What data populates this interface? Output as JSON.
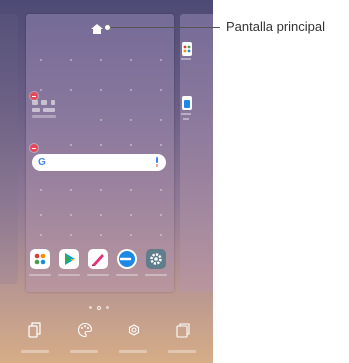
{
  "callout": {
    "label": "Pantalla principal"
  },
  "search": {
    "logo": "G"
  },
  "colors": {
    "wallpaper_top": "#4d4a75",
    "wallpaper_bottom": "#d6ad87",
    "remove_badge": "#e64a5a",
    "search_bar": "#ffffff"
  },
  "home_card": {
    "icon": "home-icon"
  },
  "dock_apps": [
    {
      "name": "apps-folder-icon",
      "color": "#ffffff"
    },
    {
      "name": "play-store-icon",
      "color": "#ffffff"
    },
    {
      "name": "pen-icon",
      "color": "#e8307d"
    },
    {
      "name": "lg-app-icon",
      "color": "#1e88e5"
    },
    {
      "name": "settings-icon",
      "color": "#607d8b"
    }
  ],
  "right_panel_apps": [
    {
      "name": "folder-icon"
    },
    {
      "name": "app-icon"
    }
  ],
  "page_indicator": {
    "count": 3,
    "active": 1
  },
  "bottom_toolbar": [
    {
      "name": "widgets-icon"
    },
    {
      "name": "wallpaper-icon"
    },
    {
      "name": "home-settings-icon"
    },
    {
      "name": "theme-icon"
    }
  ]
}
